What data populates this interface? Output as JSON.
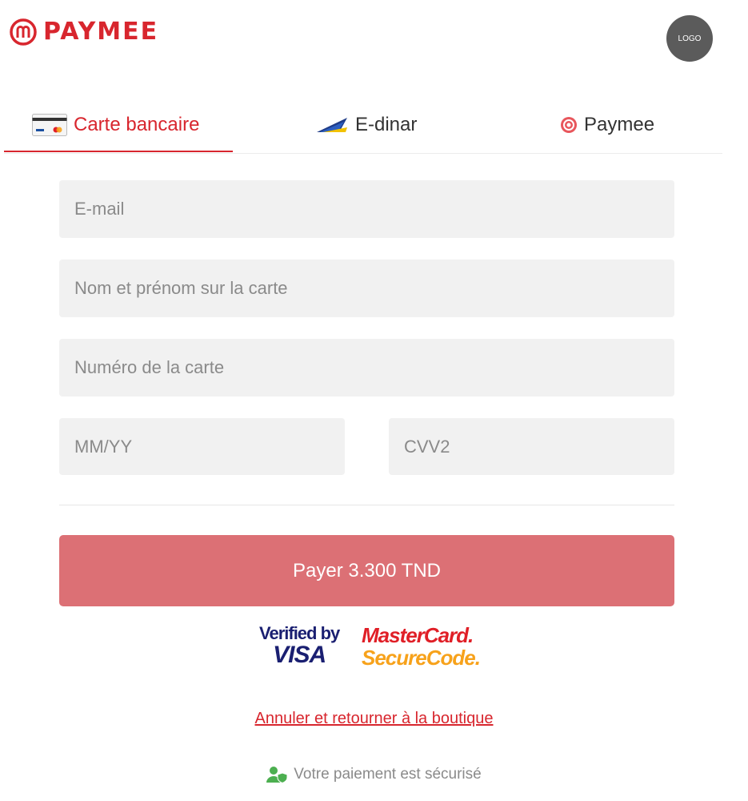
{
  "brand": {
    "name": "PAYMEE",
    "color": "#d8262e"
  },
  "merchant_logo": {
    "label": "LOGO"
  },
  "tabs": [
    {
      "label": "Carte bancaire",
      "icon": "credit-card-icon",
      "active": true
    },
    {
      "label": "E-dinar",
      "icon": "e-dinar-icon",
      "active": false
    },
    {
      "label": "Paymee",
      "icon": "paymee-icon",
      "active": false
    }
  ],
  "form": {
    "email_placeholder": "E-mail",
    "name_placeholder": "Nom et prénom sur la carte",
    "card_placeholder": "Numéro de la carte",
    "expiry_placeholder": "MM/YY",
    "cvv_placeholder": "CVV2"
  },
  "pay_button": {
    "label": "Payer 3.300 TND",
    "color": "#dc7075"
  },
  "badges": {
    "visa_line1": "Verified by",
    "visa_line2": "VISA",
    "mastercard_line1": "MasterCard.",
    "mastercard_line2": "SecureCode."
  },
  "cancel_link": "Annuler et retourner à la boutique",
  "secure_text": "Votre paiement est sécurisé"
}
